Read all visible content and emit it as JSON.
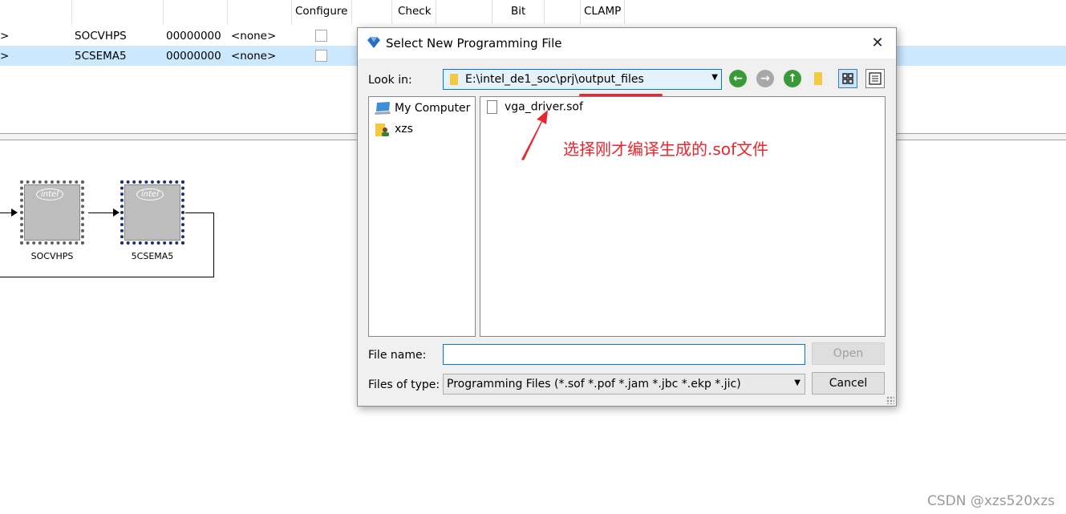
{
  "table": {
    "headers": [
      "Configure",
      "Check",
      "Bit",
      "CLAMP"
    ],
    "rows": [
      {
        "arrow": ">",
        "device": "SOCVHPS",
        "checksum": "00000000",
        "usercode": "<none>",
        "selected": false
      },
      {
        "arrow": ">",
        "device": "5CSEMA5",
        "checksum": "00000000",
        "usercode": "<none>",
        "selected": true
      }
    ]
  },
  "chain": {
    "chips": [
      {
        "label": "SOCVHPS",
        "logo": "intel"
      },
      {
        "label": "5CSEMA5",
        "logo": "intel"
      }
    ]
  },
  "dialog": {
    "title": "Select New Programming File",
    "look_in_label": "Look in:",
    "look_in_path": "E:\\intel_de1_soc\\prj\\output_files",
    "sidebar": [
      {
        "label": "My Computer",
        "icon": "computer-icon"
      },
      {
        "label": "xzs",
        "icon": "user-folder-icon"
      }
    ],
    "files": [
      {
        "name": "vga_driver.sof",
        "icon": "file-icon"
      }
    ],
    "file_name_label": "File name:",
    "file_name_value": "",
    "files_of_type_label": "Files of type:",
    "files_of_type_value": "Programming Files (*.sof *.pof *.jam *.jbc *.ekp *.jic)",
    "open_label": "Open",
    "cancel_label": "Cancel"
  },
  "annotation": {
    "text": "选择刚才编译生成的.sof文件",
    "color": "#e8262d"
  },
  "watermark": "CSDN @xzs520xzs"
}
